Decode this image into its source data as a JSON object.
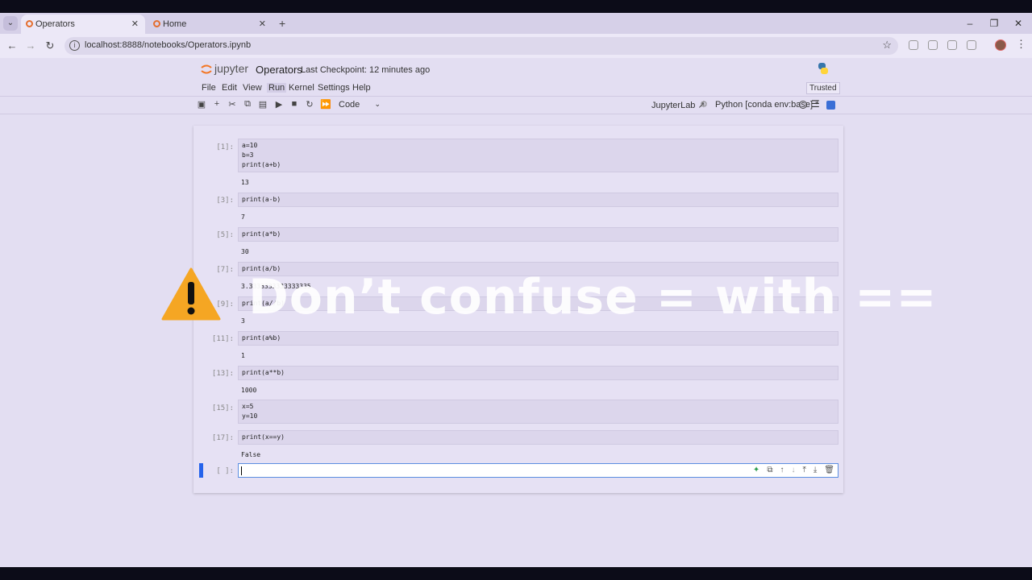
{
  "browser": {
    "tabs": [
      {
        "label": "Operators",
        "active": true
      },
      {
        "label": "Home",
        "active": false
      }
    ],
    "url": "localhost:8888/notebooks/Operators.ipynb"
  },
  "jupyter": {
    "logo_text": "jupyter",
    "notebook_title": "Operators",
    "checkpoint": "Last Checkpoint: 12 minutes ago",
    "menu": [
      "File",
      "Edit",
      "View",
      "Run",
      "Kernel",
      "Settings",
      "Help"
    ],
    "trusted": "Trusted",
    "cell_type": "Code",
    "jupyterlab_link": "JupyterLab",
    "kernel": "Python [conda env:base] *"
  },
  "cells": [
    {
      "prompt": "[1]:",
      "code": "a=10\nb=3\nprint(a+b)",
      "output": "13"
    },
    {
      "prompt": "[3]:",
      "code": "print(a-b)",
      "output": "7"
    },
    {
      "prompt": "[5]:",
      "code": "print(a*b)",
      "output": "30"
    },
    {
      "prompt": "[7]:",
      "code": "print(a/b)",
      "output": "3.3333333333333335"
    },
    {
      "prompt": "[9]:",
      "code": "print(a//b)",
      "output": "3"
    },
    {
      "prompt": "[11]:",
      "code": "print(a%b)",
      "output": "1"
    },
    {
      "prompt": "[13]:",
      "code": "print(a**b)",
      "output": "1000"
    },
    {
      "prompt": "[15]:",
      "code": "x=5\ny=10",
      "output": ""
    },
    {
      "prompt": "[17]:",
      "code": "print(x==y)",
      "output": "False"
    }
  ],
  "active_cell": {
    "prompt": "[ ]:"
  },
  "overlay": {
    "text": "Don’t confuse = with ==",
    "accent": "#f5a623"
  }
}
